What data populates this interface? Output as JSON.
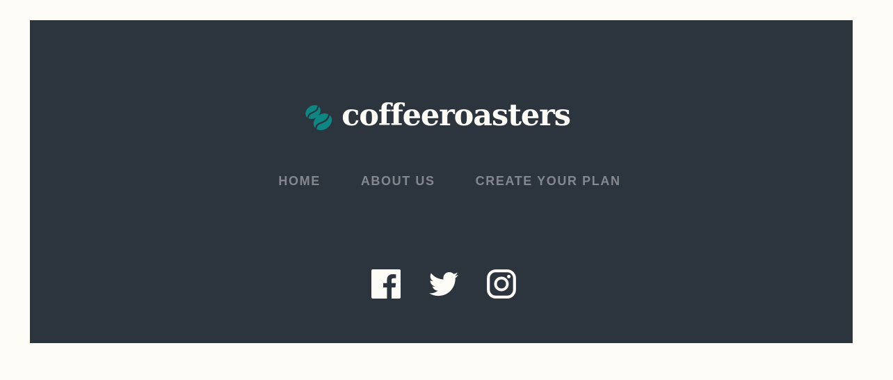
{
  "brand": {
    "name": "coffeeroasters",
    "logo_icon": "coffee-bean-icon",
    "accent_color": "#0E8784",
    "text_color": "#FEFCF7"
  },
  "footer": {
    "background": "#2C343E",
    "nav": [
      {
        "label": "HOME"
      },
      {
        "label": "ABOUT US"
      },
      {
        "label": "CREATE YOUR PLAN"
      }
    ],
    "socials": [
      {
        "icon": "facebook-icon"
      },
      {
        "icon": "twitter-icon"
      },
      {
        "icon": "instagram-icon"
      }
    ]
  }
}
